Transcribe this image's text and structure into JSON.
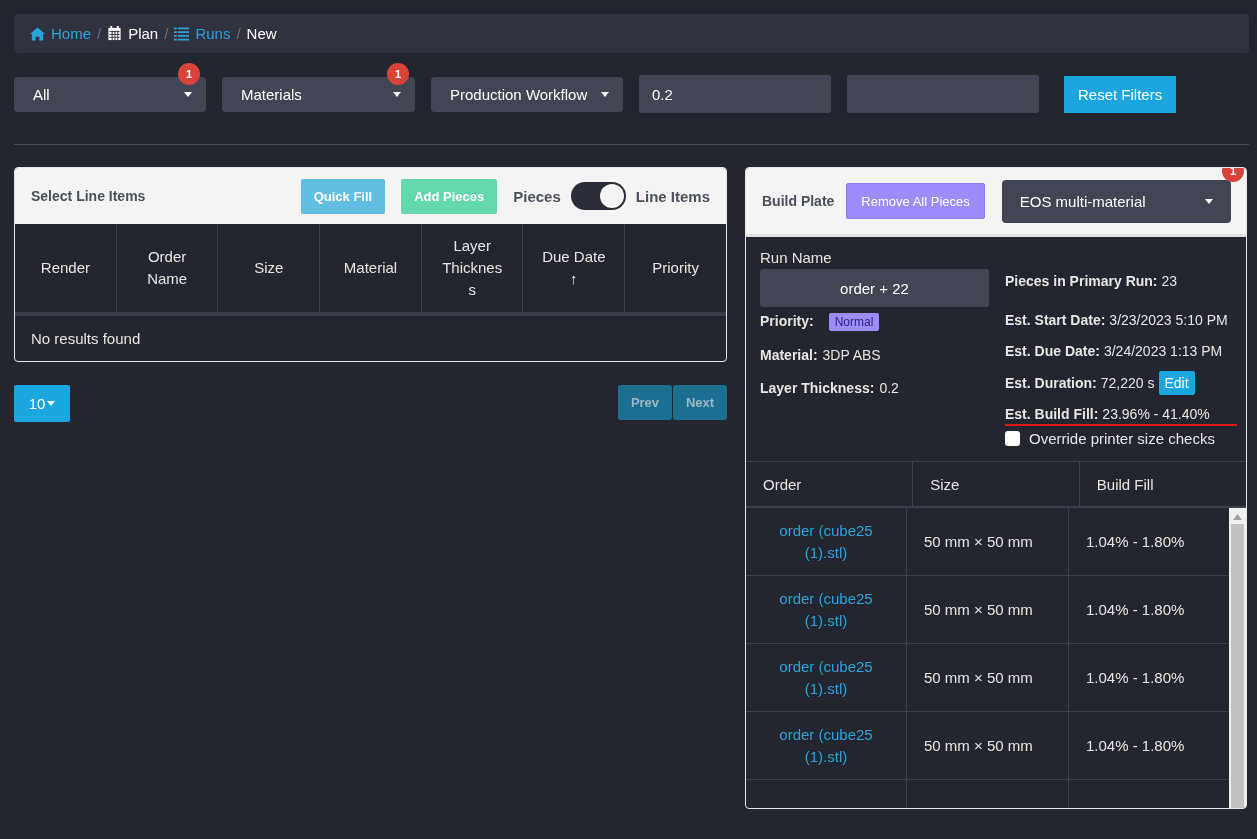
{
  "breadcrumb": {
    "separator": "/",
    "items": [
      {
        "label": "Home",
        "link": true
      },
      {
        "label": "Plan",
        "link": false
      },
      {
        "label": "Runs",
        "link": true
      },
      {
        "label": "New",
        "link": false
      }
    ]
  },
  "filters": [
    {
      "kind": "dropdown",
      "label": "All",
      "badge": "1"
    },
    {
      "kind": "dropdown",
      "label": "Materials",
      "badge": "1"
    },
    {
      "kind": "dropdown",
      "label": "Production Workflow"
    },
    {
      "kind": "input",
      "value": "0.2"
    },
    {
      "kind": "input"
    },
    {
      "kind": "button",
      "label": "Reset Filters"
    }
  ],
  "line_items": {
    "title": "Select Line Items",
    "buttons": [
      {
        "label": "Quick Fill",
        "kind": "info"
      },
      {
        "label": "Add Pieces",
        "kind": "success"
      }
    ],
    "toggle": {
      "left_label": "Pieces",
      "right_label": "Line Items",
      "on": true
    },
    "columns": [
      "Render",
      "Order Name",
      "Size",
      "Material",
      "Layer Thickness",
      "Due Date ↑",
      "Priority"
    ],
    "empty_text": "No results found"
  },
  "pagination": {
    "page_size": "10",
    "prev": "Prev",
    "next": "Next"
  },
  "build_plate": {
    "title": "Build Plate",
    "remove_button": "Remove All Pieces",
    "printer": {
      "label": "EOS multi-material",
      "badge": "1"
    },
    "run_name_label": "Run Name",
    "run_name": "order + 22",
    "left_fields": [
      {
        "label": "Priority:",
        "value": "Normal",
        "kind": "tag"
      },
      {
        "label": "Material:",
        "value": "3DP ABS",
        "kind": "text"
      },
      {
        "label": "Layer Thickness:",
        "value": "0.2",
        "kind": "text"
      }
    ],
    "right_fields": [
      {
        "label": "Pieces in Primary Run:",
        "value": "23",
        "underlined": false
      },
      {
        "label": "Est. Start Date:",
        "value": "3/23/2023 5:10 PM",
        "underlined": false
      },
      {
        "label": "Est. Due Date:",
        "value": "3/24/2023 1:13 PM",
        "underlined": false
      },
      {
        "label": "Est. Duration:",
        "value": "72,220 s",
        "edit": "Edit",
        "underlined": false
      },
      {
        "label": "Est. Build Fill:",
        "value": "23.96% - 41.40%",
        "underlined": true
      }
    ],
    "override": {
      "label": "Override printer size checks",
      "checked": false
    },
    "columns": [
      "Order",
      "Size",
      "Build Fill"
    ],
    "rows": [
      {
        "order": "order (cube25 (1).stl)",
        "size": "50 mm × 50 mm",
        "fill": "1.04% - 1.80%"
      },
      {
        "order": "order (cube25 (1).stl)",
        "size": "50 mm × 50 mm",
        "fill": "1.04% - 1.80%"
      },
      {
        "order": "order (cube25 (1).stl)",
        "size": "50 mm × 50 mm",
        "fill": "1.04% - 1.80%"
      },
      {
        "order": "order (cube25 (1).stl)",
        "size": "50 mm × 50 mm",
        "fill": "1.04% - 1.80%"
      }
    ]
  }
}
